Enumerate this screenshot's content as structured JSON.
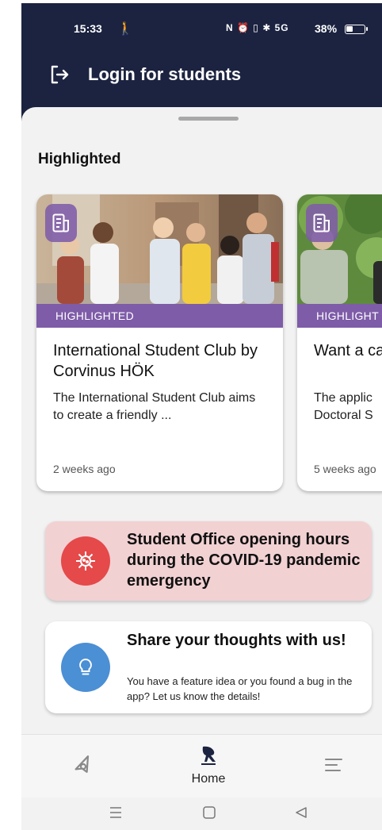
{
  "status_bar": {
    "time": "15:33",
    "activity_icon": "walking-person-icon",
    "indicators": "N ⏰ ▯ ✱ 5G ",
    "battery_text": "38%",
    "battery_level_fraction": 0.38
  },
  "header": {
    "login_label": "Login for students",
    "login_icon": "login-arrow-icon",
    "background_color": "#1c2340"
  },
  "highlighted": {
    "section_title": "Highlighted",
    "cards": [
      {
        "tag": "HIGHLIGHTED",
        "title": "International Student Club by Corvinus HÖK",
        "description": "The International Student Club aims to create a friendly ...",
        "time": "2 weeks ago"
      },
      {
        "tag": "HIGHLIGHT",
        "title": "Want a ca",
        "description_line1": "The applic",
        "description_line2": "Doctoral S",
        "time": "5 weeks ago"
      }
    ],
    "tag_color": "#7e5ca8"
  },
  "covid_banner": {
    "title": "Student Office opening hours during the COVID-19 pandemic emergency",
    "icon": "virus-icon",
    "color": "#e5494a"
  },
  "feedback_banner": {
    "title": "Share your thoughts with us!",
    "subtitle": "You have a feature idea or you found a bug in the app? Let us know the details!",
    "icon": "lightbulb-icon",
    "color": "#4b8fd4"
  },
  "bottom_nav": {
    "items": [
      {
        "icon": "compass-icon",
        "label": ""
      },
      {
        "icon": "home-logo-icon",
        "label": "Home"
      },
      {
        "icon": "menu-lines-icon",
        "label": ""
      }
    ]
  }
}
